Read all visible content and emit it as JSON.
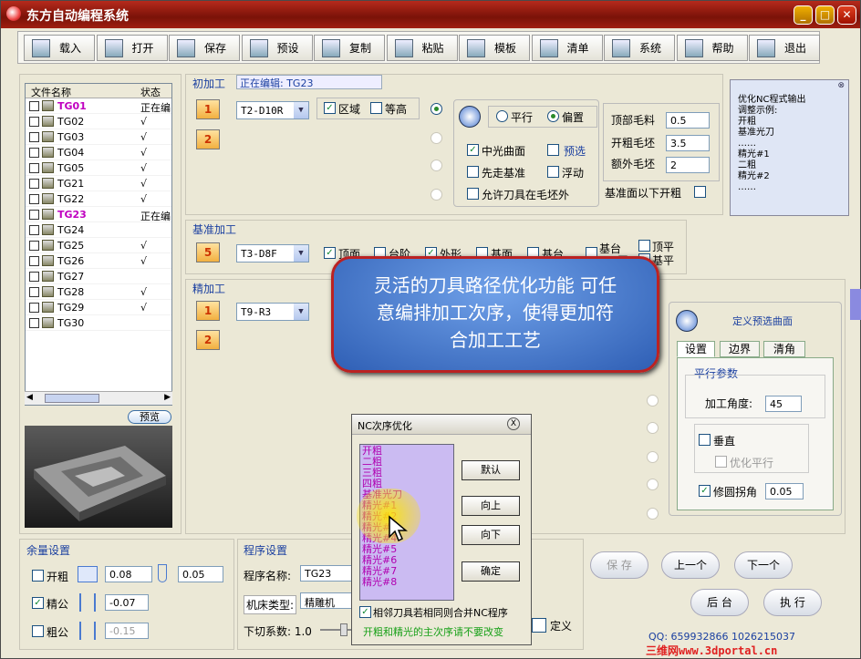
{
  "window": {
    "title": "东方自动编程系统",
    "min": "_",
    "max": "□",
    "close": "✕"
  },
  "toolbar": [
    {
      "label": "载入",
      "icon": "load-icon"
    },
    {
      "label": "打开",
      "icon": "open-icon"
    },
    {
      "label": "保存",
      "icon": "save-icon"
    },
    {
      "label": "预设",
      "icon": "preset-icon"
    },
    {
      "label": "复制",
      "icon": "copy-icon"
    },
    {
      "label": "粘贴",
      "icon": "paste-icon"
    },
    {
      "label": "模板",
      "icon": "template-icon"
    },
    {
      "label": "清单",
      "icon": "list-icon"
    },
    {
      "label": "系统",
      "icon": "system-icon"
    },
    {
      "label": "帮助",
      "icon": "help-icon"
    },
    {
      "label": "退出",
      "icon": "exit-icon"
    }
  ],
  "files": {
    "col_name": "文件名称",
    "col_status": "状态",
    "rows": [
      {
        "name": "TG01",
        "status": "正在编",
        "hl": true
      },
      {
        "name": "TG02",
        "status": "√"
      },
      {
        "name": "TG03",
        "status": "√"
      },
      {
        "name": "TG04",
        "status": "√"
      },
      {
        "name": "TG05",
        "status": "√"
      },
      {
        "name": "TG21",
        "status": "√"
      },
      {
        "name": "TG22",
        "status": "√"
      },
      {
        "name": "TG23",
        "status": "正在编",
        "hl": true
      },
      {
        "name": "TG24",
        "status": ""
      },
      {
        "name": "TG25",
        "status": "√"
      },
      {
        "name": "TG26",
        "status": "√"
      },
      {
        "name": "TG27",
        "status": ""
      },
      {
        "name": "TG28",
        "status": "√"
      },
      {
        "name": "TG29",
        "status": "√"
      },
      {
        "name": "TG30",
        "status": ""
      }
    ],
    "preview": "预览"
  },
  "rough": {
    "label": "初加工",
    "editing": "正在编辑:  TG23",
    "tool": "T2-D10R",
    "area": "区域",
    "contour": "等高",
    "parallel": "平行",
    "offset": "偏置",
    "mid": "中光曲面",
    "preselect": "预选",
    "first": "先走基准",
    "float": "浮动",
    "allow": "允许刀具在毛坯外",
    "top_stock": "顶部毛料",
    "top_stock_v": "0.5",
    "open_blank": "开粗毛坯",
    "open_blank_v": "3.5",
    "extra_blank": "额外毛坯",
    "extra_blank_v": "2",
    "below": "基准面以下开粗"
  },
  "base": {
    "label": "基准加工",
    "tool": "T3-D8F",
    "top": "顶面",
    "step": "台阶",
    "shape": "外形",
    "base": "基面",
    "table": "基台",
    "baseplat": "基台",
    "flat": "平",
    "top_flat": "顶平",
    "base_flat": "基平"
  },
  "finish": {
    "label": "精加工",
    "tool": "T9-R3"
  },
  "bubble": {
    "line1": "灵活的刀具路径优化功能  可任",
    "line2": "意编排加工次序，使得更加符",
    "line3": "合加工工艺"
  },
  "side_note": {
    "lines": "优化NC程式输出\n调整示例:\n开粗\n基准光刀\n……\n精光#1\n二粗\n精光#2\n……"
  },
  "define": {
    "title": "定义预选曲面",
    "tabs": [
      "设置",
      "边界",
      "清角"
    ],
    "group": "平行参数",
    "angle_label": "加工角度:",
    "angle": "45",
    "vertical": "垂直",
    "opt_parallel": "优化平行",
    "corner": "修圆拐角",
    "corner_v": "0.05"
  },
  "allowance": {
    "label": "余量设置",
    "rough": "开粗",
    "rough_v1": "0.08",
    "rough_v2": "0.05",
    "fine": "精公",
    "fine_v": "-0.07",
    "coarse": "粗公",
    "coarse_v": "-0.15"
  },
  "program": {
    "label": "程序设置",
    "name_label": "程序名称:",
    "name": "TG23",
    "machine_label": "机床类型:",
    "machine": "精雕机",
    "cut_label": "下切系数: 1.0",
    "define": "定义"
  },
  "nc_dialog": {
    "title": "NC次序优化",
    "items": [
      "开粗",
      "二粗",
      "三粗",
      "四粗",
      "基准光刀",
      "精光#1",
      "精光#2",
      "精光#3",
      "精光#4",
      "精光#5",
      "精光#6",
      "精光#7",
      "精光#8"
    ],
    "default": "默认",
    "up": "向上",
    "down": "向下",
    "ok": "确定",
    "merge": "相邻刀具若相同则合并NC程序",
    "note": "开粗和精光的主次序请不要改变"
  },
  "bottom": {
    "save": "保 存",
    "prev": "上一个",
    "next": "下一个",
    "back": "后 台",
    "run": "执 行"
  },
  "contact": "QQ: 659932866  1026215037",
  "watermark": "三维网www.3dportal.cn"
}
